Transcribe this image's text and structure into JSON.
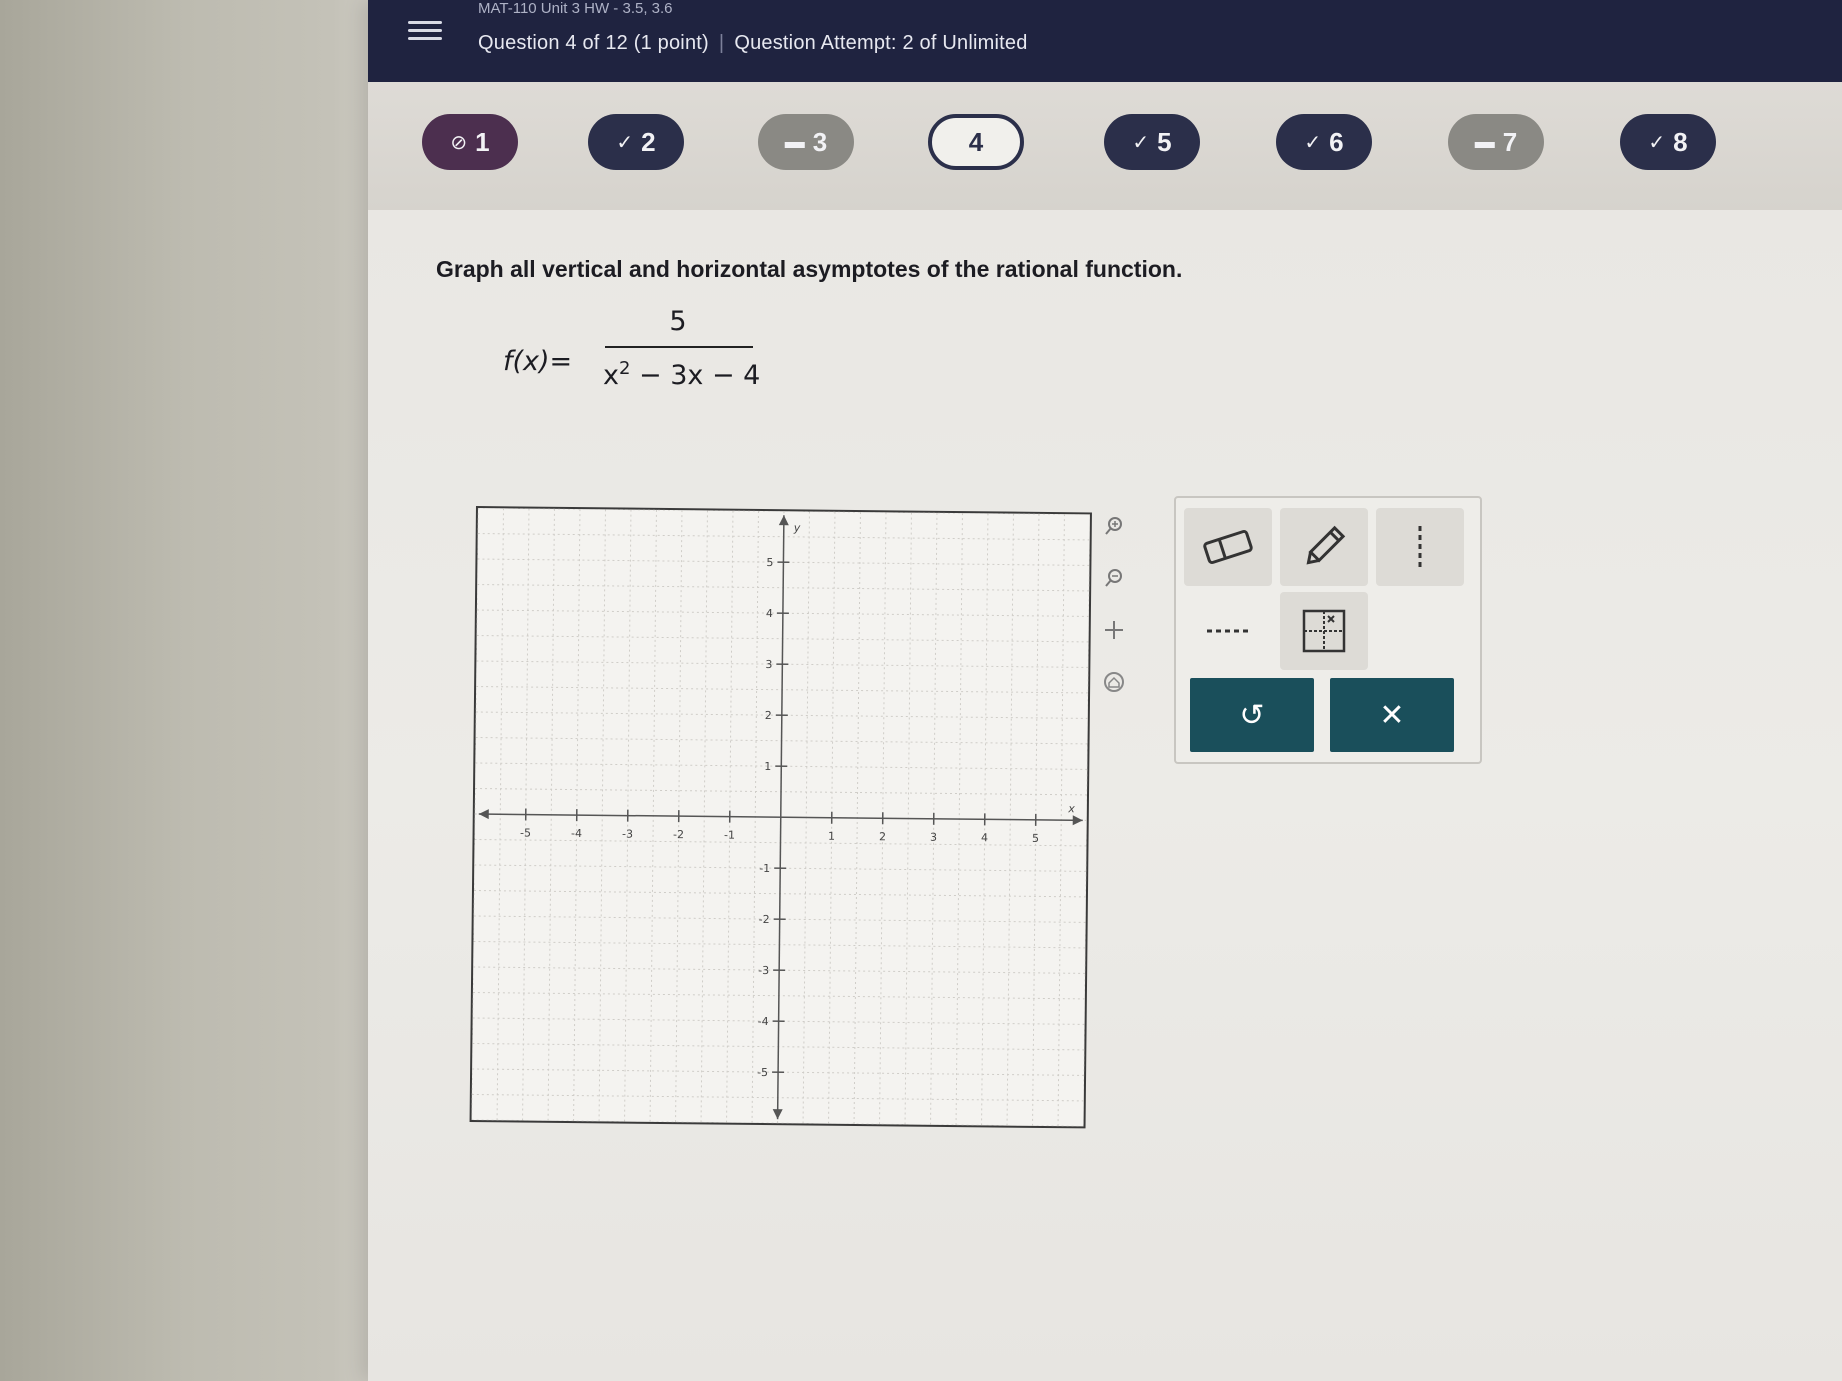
{
  "header": {
    "course_title": "MAT-110 Unit 3 HW - 3.5, 3.6",
    "question_position": "Question 4 of 12 (1 point)",
    "separator": "|",
    "attempt": "Question Attempt: 2 of Unlimited"
  },
  "question_nav": [
    {
      "label": "1",
      "mark": "⊘",
      "state": "error"
    },
    {
      "label": "2",
      "mark": "✓",
      "state": "done"
    },
    {
      "label": "3",
      "mark": "▬",
      "state": "partial"
    },
    {
      "label": "4",
      "mark": "",
      "state": "current"
    },
    {
      "label": "5",
      "mark": "✓",
      "state": "done"
    },
    {
      "label": "6",
      "mark": "✓",
      "state": "done"
    },
    {
      "label": "7",
      "mark": "▬",
      "state": "partial"
    },
    {
      "label": "8",
      "mark": "✓",
      "state": "done"
    }
  ],
  "problem": {
    "prompt": "Graph all vertical and horizontal asymptotes of the rational function.",
    "lhs": "f(x)=",
    "numerator": "5",
    "denominator_base": "x",
    "denominator_exp": "2",
    "denominator_rest": " − 3x − 4"
  },
  "graph": {
    "x_label": "x",
    "y_label": "y",
    "xlim": [
      -6,
      6
    ],
    "ylim": [
      -6,
      6
    ],
    "ticks": [
      -5,
      -4,
      -3,
      -2,
      -1,
      1,
      2,
      3,
      4,
      5
    ]
  },
  "tools": {
    "undo_symbol": "↺",
    "clear_symbol": "✕"
  }
}
